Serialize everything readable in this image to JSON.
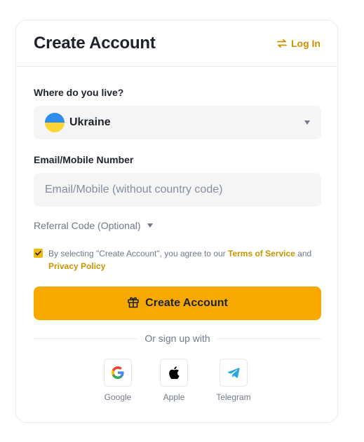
{
  "header": {
    "title": "Create Account",
    "login_label": "Log In"
  },
  "country": {
    "label": "Where do you live?",
    "selected": "Ukraine"
  },
  "email": {
    "label": "Email/Mobile Number",
    "placeholder": "Email/Mobile (without country code)",
    "value": ""
  },
  "referral": {
    "label": "Referral Code (Optional)"
  },
  "terms": {
    "checked": true,
    "prefix": "By selecting \"Create Account\", you agree to our ",
    "terms_link": "Terms of Service",
    "and": " and",
    "privacy_link": "Privacy Policy"
  },
  "cta": {
    "label": "Create Account"
  },
  "divider": {
    "label": "Or sign up with"
  },
  "social": {
    "google": "Google",
    "apple": "Apple",
    "telegram": "Telegram"
  },
  "colors": {
    "accent": "#f8a900",
    "link": "#c99400",
    "text": "#1e2329",
    "muted": "#707a8a",
    "field_bg": "#f5f5f5"
  }
}
